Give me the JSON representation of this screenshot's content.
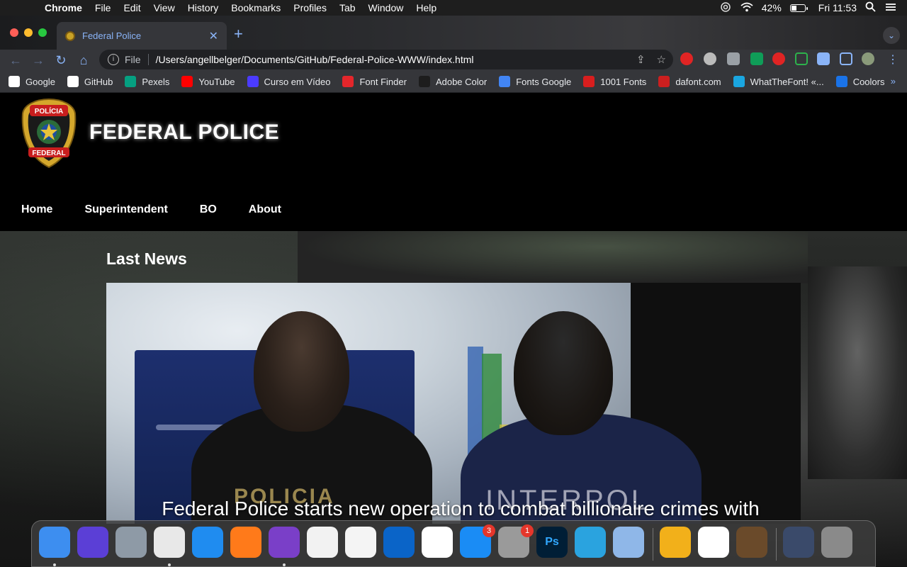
{
  "menubar": {
    "app_name": "Chrome",
    "items": [
      "File",
      "Edit",
      "View",
      "History",
      "Bookmarks",
      "Profiles",
      "Tab",
      "Window",
      "Help"
    ],
    "battery": "42%",
    "battery_level": 0.42,
    "clock": "Fri 11:53"
  },
  "browser": {
    "tab_title": "Federal Police",
    "url_scheme": "File",
    "url": "/Users/angellbelger/Documents/GitHub/Federal-Police-WWW/index.html",
    "bookmarks": [
      {
        "label": "Google",
        "color": "#ffffff"
      },
      {
        "label": "GitHub",
        "color": "#ffffff"
      },
      {
        "label": "Pexels",
        "color": "#05a081"
      },
      {
        "label": "YouTube",
        "color": "#ff0000"
      },
      {
        "label": "Curso em Vídeo",
        "color": "#4b3bff"
      },
      {
        "label": "Font Finder",
        "color": "#e4262b"
      },
      {
        "label": "Adobe Color",
        "color": "#1d1d1d"
      },
      {
        "label": "Fonts Google",
        "color": "#4285f4"
      },
      {
        "label": "1001 Fonts",
        "color": "#d81e1e"
      },
      {
        "label": "dafont.com",
        "color": "#cc1f1f"
      },
      {
        "label": "WhatTheFont! «...",
        "color": "#1aa6e0"
      },
      {
        "label": "Coolors",
        "color": "#1a73e8"
      }
    ],
    "bookmarks_more": "»"
  },
  "site": {
    "title": "FEDERAL POLICE",
    "logo_text_top": "POLÍCIA",
    "logo_text_bottom": "FEDERAL",
    "nav": [
      "Home",
      "Superintendent",
      "BO",
      "About"
    ],
    "news_heading": "Last News",
    "news_photo_text_1": "POLICIA",
    "news_photo_text_2": "INTERPOL",
    "news_caption": "Federal Police starts new operation to combat billionaire crimes with"
  },
  "dock": {
    "apps": [
      {
        "name": "finder",
        "color": "#3d8ef0"
      },
      {
        "name": "siri",
        "color": "#5b3fd6"
      },
      {
        "name": "launchpad",
        "color": "#8e9aa6"
      },
      {
        "name": "chrome",
        "color": "#e8e8e8"
      },
      {
        "name": "safari",
        "color": "#1f8cf0"
      },
      {
        "name": "firefox",
        "color": "#ff7a1a"
      },
      {
        "name": "github-desktop",
        "color": "#7a3fc8"
      },
      {
        "name": "photos",
        "color": "#f2f2f2"
      },
      {
        "name": "music",
        "color": "#f4f4f4"
      },
      {
        "name": "outlook",
        "color": "#0a64c8"
      },
      {
        "name": "word",
        "color": "#ffffff"
      },
      {
        "name": "app-store",
        "color": "#1a8cf5",
        "badge": "3"
      },
      {
        "name": "system-preferences",
        "color": "#9a9a9a",
        "badge": "1"
      },
      {
        "name": "photoshop",
        "color": "#001e36",
        "glyph": "Ps"
      },
      {
        "name": "telegram",
        "color": "#2aa3df"
      },
      {
        "name": "xcode-helper",
        "color": "#8fb7e8"
      },
      {
        "name": "bluestacks",
        "color": "#f2b01a"
      },
      {
        "name": "excel",
        "color": "#ffffff"
      },
      {
        "name": "video-player",
        "color": "#6a4a2a"
      },
      {
        "name": "preview-stack",
        "color": "#3a4a6a"
      },
      {
        "name": "trash",
        "color": "#8a8a8a"
      }
    ]
  }
}
